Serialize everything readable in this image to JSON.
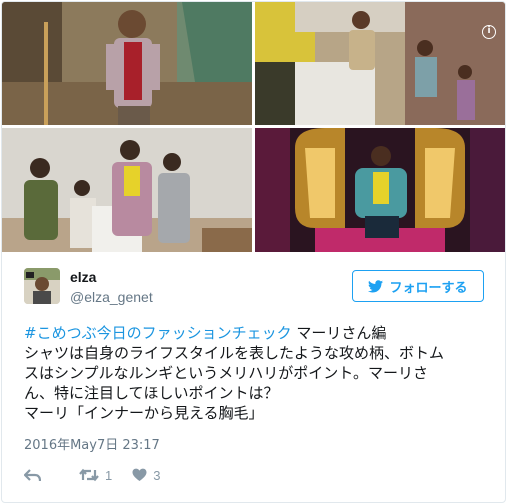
{
  "media": {
    "photos": [
      {
        "description": "man in floral shirt"
      },
      {
        "description": "street scene"
      },
      {
        "description": "group of men"
      },
      {
        "description": "stage lights"
      }
    ],
    "info_icon": "i"
  },
  "user": {
    "name": "elza",
    "handle": "@elza_genet",
    "avatar_icon": "profile-photo"
  },
  "follow_button": {
    "label": "フォローする",
    "icon": "twitter-bird-icon",
    "color": "#1da1f2"
  },
  "tweet": {
    "hashtag": "#こめつぶ今日のファッションチェック",
    "line1_rest": " マーリさん編",
    "line2": "シャツは自身のライフスタイルを表したような攻め柄、ボトム",
    "line3": "スはシンプルなルンギというメリハリがポイント。マーリさ",
    "line4": "ん、特に注目してほしいポイントは？",
    "line5": "マーリ「インナーから見える胸毛」",
    "timestamp": "2016年May7日 23:17"
  },
  "actions": {
    "reply_icon": "reply-icon",
    "retweet_count": "1",
    "like_count": "3"
  },
  "colors": {
    "link": "#1b95e0",
    "muted": "#657786",
    "border": "#e1e8ed"
  }
}
